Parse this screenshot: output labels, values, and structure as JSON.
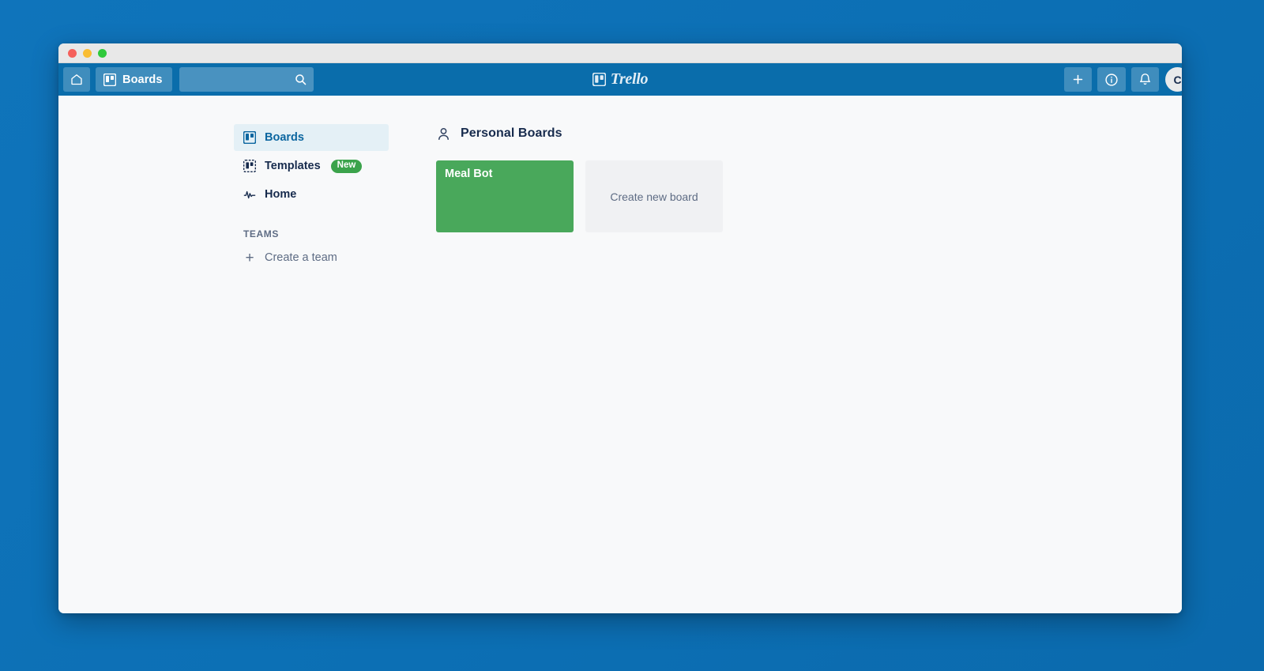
{
  "window": {
    "traffic_lights": [
      "close",
      "minimize",
      "maximize"
    ]
  },
  "topnav": {
    "home_icon": "home-icon",
    "boards_label": "Boards",
    "boards_icon": "board-icon",
    "search": {
      "value": "",
      "placeholder": "",
      "icon": "search-icon"
    },
    "brand": {
      "name": "Trello",
      "logo_icon": "trello-logo-icon"
    },
    "actions": [
      {
        "name": "add-button",
        "icon": "plus-icon",
        "label": "+"
      },
      {
        "name": "info-button",
        "icon": "info-circle-icon"
      },
      {
        "name": "notifications-button",
        "icon": "bell-icon"
      }
    ],
    "avatar": {
      "initials": "C"
    }
  },
  "sidebar": {
    "items": [
      {
        "label": "Boards",
        "icon": "board-icon",
        "active": true
      },
      {
        "label": "Templates",
        "icon": "template-icon",
        "badge": "New",
        "active": false
      },
      {
        "label": "Home",
        "icon": "activity-pulse-icon",
        "active": false
      }
    ],
    "teams_heading": "TEAMS",
    "create_team_label": "Create a team",
    "create_team_icon": "plus-icon"
  },
  "main": {
    "section": {
      "title": "Personal Boards",
      "icon": "person-icon"
    },
    "boards": [
      {
        "title": "Meal Bot",
        "color": "#49a85b",
        "type": "board"
      },
      {
        "title": "Create new board",
        "color": "#f0f1f3",
        "type": "create"
      }
    ]
  },
  "colors": {
    "desktop_background": "#0d72b9",
    "topnav": "#0a6dab",
    "content_background": "#f8f9fa",
    "accent_blue": "#0c66a0",
    "board_green": "#49a85b",
    "badge_green": "#3ba34b",
    "muted_text": "#5e6c84",
    "dark_text": "#172b4d"
  }
}
